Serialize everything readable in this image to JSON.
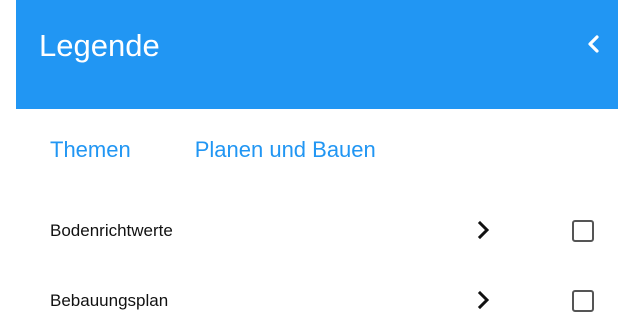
{
  "header": {
    "title": "Legende",
    "collapse_icon": "chevron-left-icon",
    "background_color": "#2196f3"
  },
  "breadcrumb": {
    "items": [
      {
        "label": "Themen"
      },
      {
        "label": "Planen und Bauen"
      }
    ],
    "link_color": "#2196f3"
  },
  "layers": [
    {
      "label": "Bodenrichtwerte",
      "expand_icon": "chevron-right-icon",
      "checked": false
    },
    {
      "label": "Bebauungsplan",
      "expand_icon": "chevron-right-icon",
      "checked": false
    }
  ]
}
